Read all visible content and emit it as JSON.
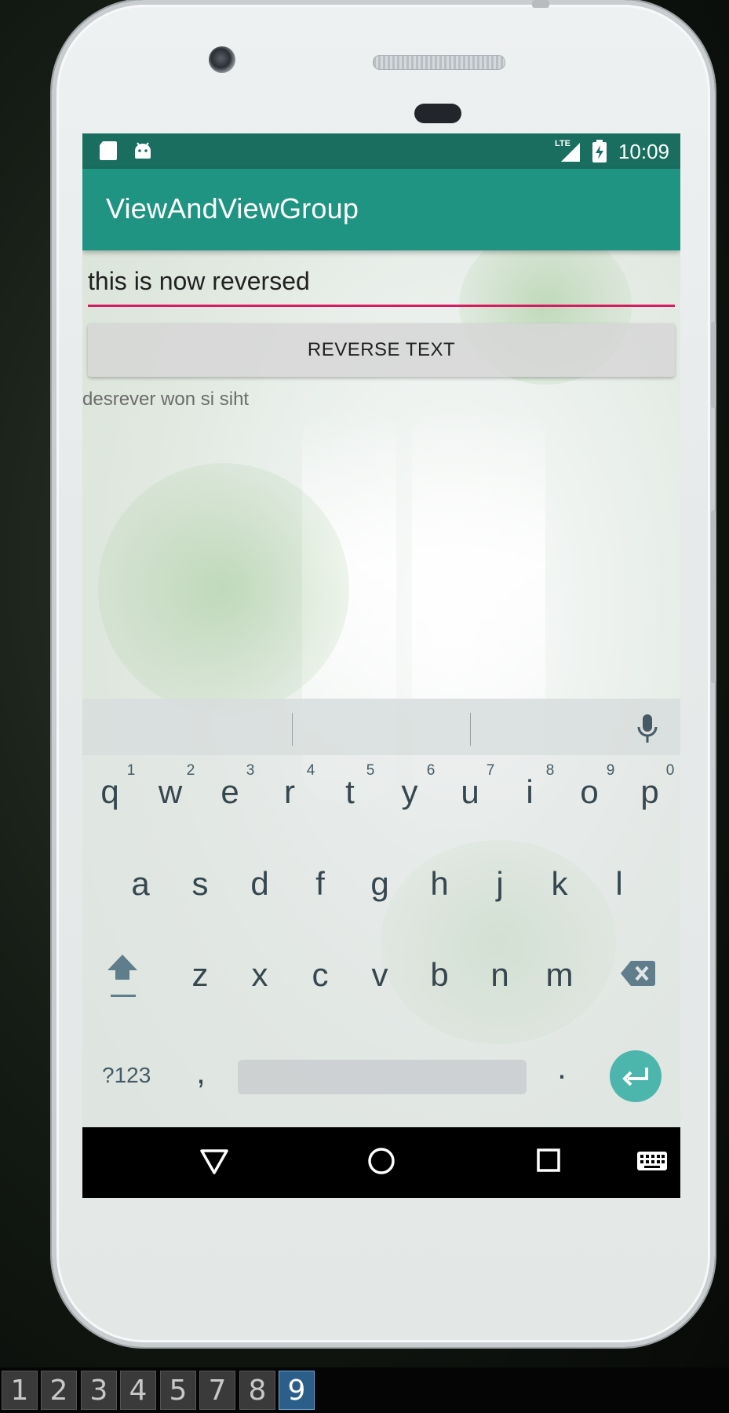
{
  "status_bar": {
    "time": "10:09",
    "lte_label": "LTE",
    "icons": [
      "sd-card-icon",
      "android-icon",
      "signal-lte-icon",
      "battery-charging-icon"
    ]
  },
  "app_bar": {
    "title": "ViewAndViewGroup"
  },
  "input": {
    "value": "this is now reversed"
  },
  "button": {
    "label": "REVERSE TEXT"
  },
  "result": {
    "text": "desrever won si siht"
  },
  "keyboard": {
    "row1": [
      "q",
      "w",
      "e",
      "r",
      "t",
      "y",
      "u",
      "i",
      "o",
      "p"
    ],
    "row1_hints": [
      "1",
      "2",
      "3",
      "4",
      "5",
      "6",
      "7",
      "8",
      "9",
      "0"
    ],
    "row2": [
      "a",
      "s",
      "d",
      "f",
      "g",
      "h",
      "j",
      "k",
      "l"
    ],
    "row3": [
      "z",
      "x",
      "c",
      "v",
      "b",
      "n",
      "m"
    ],
    "symbols_label": "?123",
    "comma": ",",
    "period": ".",
    "icons": [
      "shift-icon",
      "backspace-icon",
      "enter-icon",
      "microphone-icon"
    ]
  },
  "nav_bar": {
    "icons": [
      "back-icon",
      "home-icon",
      "recents-icon",
      "keyboard-icon"
    ]
  },
  "taskbar": {
    "workspaces": [
      "1",
      "2",
      "3",
      "4",
      "5",
      "7",
      "8",
      "9"
    ],
    "active": "9"
  },
  "colors": {
    "status_bar": "#196e5f",
    "app_bar": "#1f9483",
    "input_underline": "#d81b60",
    "enter_key": "#4db6ac"
  }
}
